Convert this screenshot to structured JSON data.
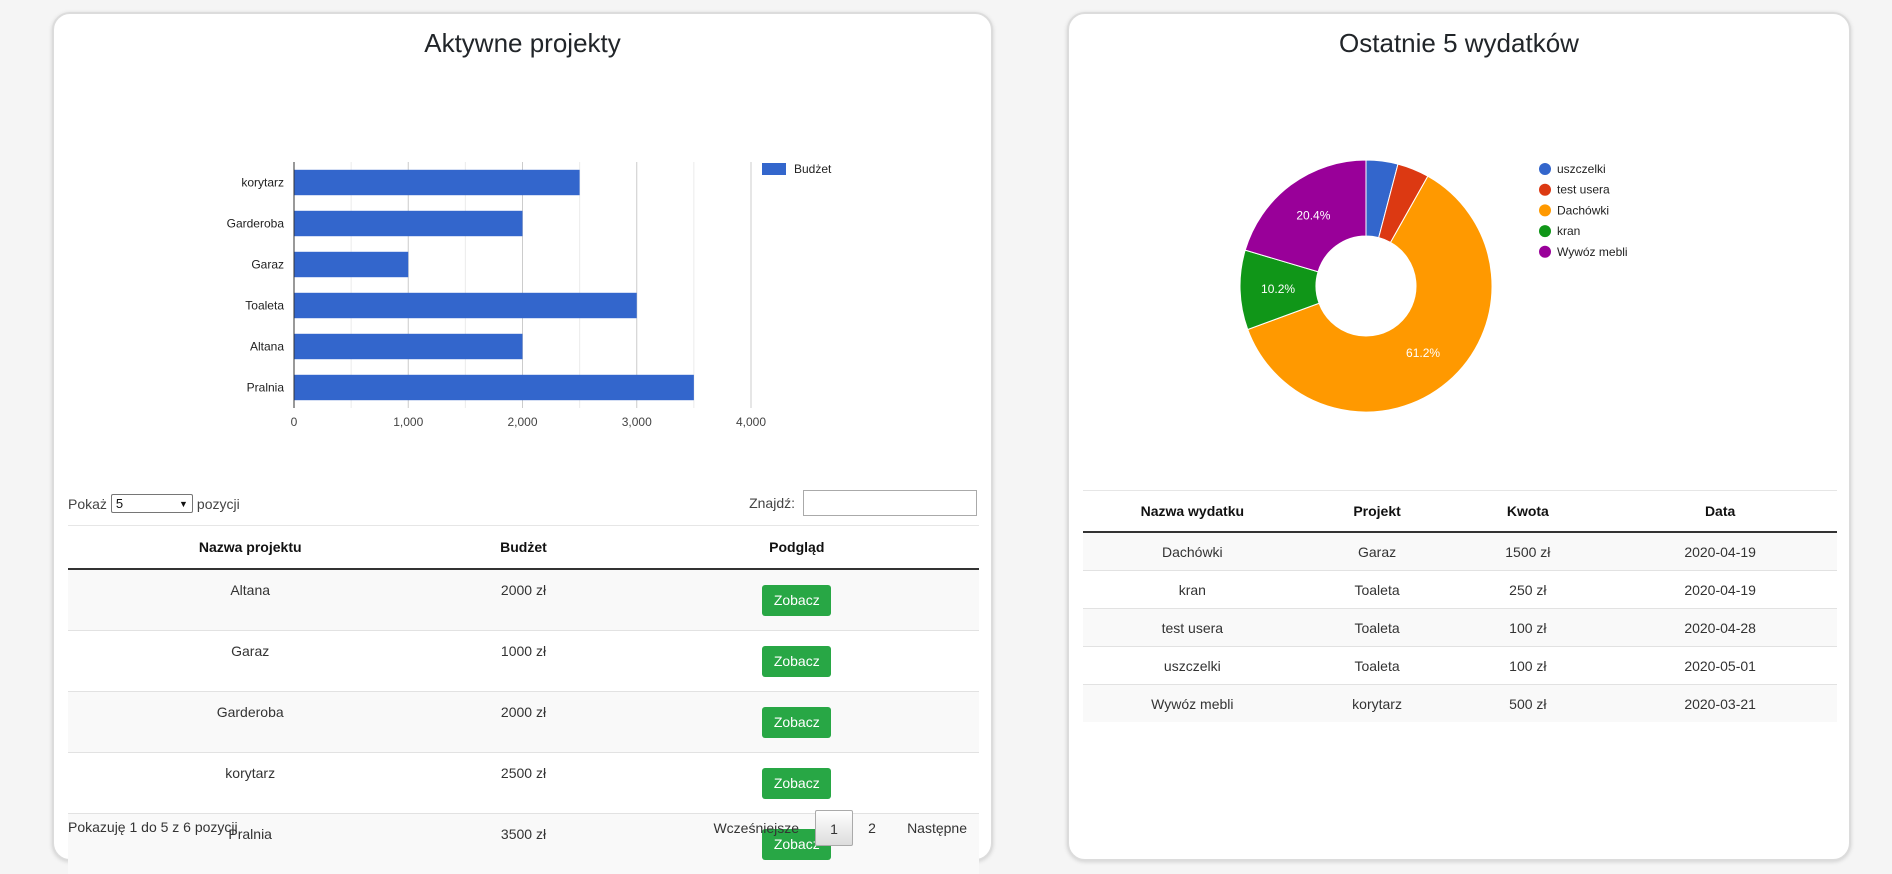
{
  "projects_card": {
    "title": "Aktywne projekty",
    "length_prefix": "Pokaż",
    "length_value": "5",
    "length_suffix": "pozycji",
    "search_label": "Znajdź:",
    "columns": [
      "Nazwa projektu",
      "Budżet",
      "Podgląd"
    ],
    "rows": [
      {
        "name": "Altana",
        "budget": "2000 zł",
        "action": "Zobacz"
      },
      {
        "name": "Garaz",
        "budget": "1000 zł",
        "action": "Zobacz"
      },
      {
        "name": "Garderoba",
        "budget": "2000 zł",
        "action": "Zobacz"
      },
      {
        "name": "korytarz",
        "budget": "2500 zł",
        "action": "Zobacz"
      },
      {
        "name": "Pralnia",
        "budget": "3500 zł",
        "action": "Zobacz"
      }
    ],
    "info": "Pokazuję 1 do 5 z 6 pozycji",
    "pagination": {
      "prev": "Wcześniejsze",
      "pages": [
        "1",
        "2"
      ],
      "current": "1",
      "next": "Następne"
    }
  },
  "expenses_card": {
    "title": "Ostatnie 5 wydatków",
    "columns": [
      "Nazwa wydatku",
      "Projekt",
      "Kwota",
      "Data"
    ],
    "rows": [
      {
        "name": "Dachówki",
        "project": "Garaz",
        "amount": "1500 zł",
        "date": "2020-04-19"
      },
      {
        "name": "kran",
        "project": "Toaleta",
        "amount": "250 zł",
        "date": "2020-04-19"
      },
      {
        "name": "test usera",
        "project": "Toaleta",
        "amount": "100 zł",
        "date": "2020-04-28"
      },
      {
        "name": "uszczelki",
        "project": "Toaleta",
        "amount": "100 zł",
        "date": "2020-05-01"
      },
      {
        "name": "Wywóz mebli",
        "project": "korytarz",
        "amount": "500 zł",
        "date": "2020-03-21"
      }
    ]
  },
  "chart_data": [
    {
      "type": "bar",
      "orientation": "horizontal",
      "categories": [
        "korytarz",
        "Garderoba",
        "Garaz",
        "Toaleta",
        "Altana",
        "Pralnia"
      ],
      "series": [
        {
          "name": "Budżet",
          "values": [
            2500,
            2000,
            1000,
            3000,
            2000,
            3500
          ],
          "color": "#3366cc"
        }
      ],
      "xlim": [
        0,
        4000
      ],
      "xticks": [
        "0",
        "1,000",
        "2,000",
        "3,000",
        "4,000"
      ],
      "grid": true,
      "legend": "right"
    },
    {
      "type": "pie",
      "donut": true,
      "labels": [
        "uszczelki",
        "test usera",
        "Dachówki",
        "kran",
        "Wywóz mebli"
      ],
      "values": [
        100,
        100,
        1500,
        250,
        500
      ],
      "colors": [
        "#3366cc",
        "#dc3912",
        "#ff9900",
        "#109618",
        "#990099"
      ],
      "slice_labels": [
        "",
        "",
        "61.2%",
        "10.2%",
        "20.4%"
      ],
      "legend": "right"
    }
  ]
}
